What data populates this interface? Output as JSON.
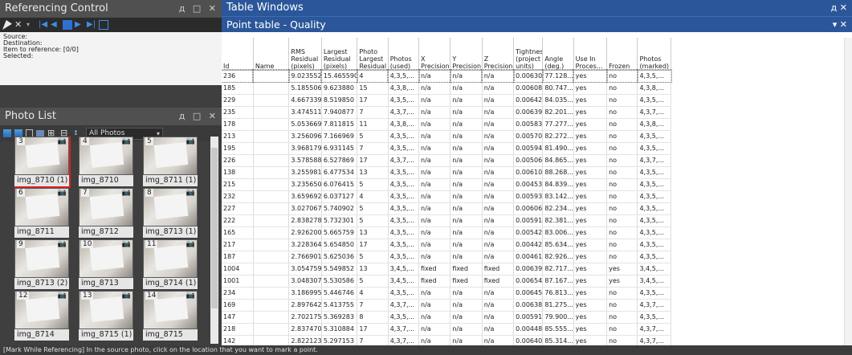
{
  "referencing_control": {
    "title": "Referencing Control",
    "controls": "д □ ✕",
    "info": [
      "Source:",
      "Destination:",
      "Item to reference:  [0/0]",
      "Selected:"
    ]
  },
  "photo_list": {
    "title": "Photo List",
    "controls": "д □ ✕",
    "filter": "All Photos",
    "photos": [
      {
        "num": "3",
        "label": "img_8710 (1)",
        "selected": true
      },
      {
        "num": "4",
        "label": "img_8710",
        "selected": false
      },
      {
        "num": "5",
        "label": "img_8711 (1)",
        "selected": false
      },
      {
        "num": "6",
        "label": "img_8711",
        "selected": false
      },
      {
        "num": "7",
        "label": "img_8712",
        "selected": false
      },
      {
        "num": "8",
        "label": "img_8713 (1)",
        "selected": false
      },
      {
        "num": "9",
        "label": "img_8713 (2)",
        "selected": false
      },
      {
        "num": "10",
        "label": "img_8713",
        "selected": false
      },
      {
        "num": "11",
        "label": "img_8714 (1)",
        "selected": false
      },
      {
        "num": "12",
        "label": "img_8714",
        "selected": false
      },
      {
        "num": "13",
        "label": "img_8715 (1)",
        "selected": false
      },
      {
        "num": "14",
        "label": "img_8715",
        "selected": false
      }
    ]
  },
  "table_windows": {
    "title": "Table Windows",
    "controls": "д ✕",
    "subtitle": "Point table - Quality",
    "sub_controls": "▾ ✕"
  },
  "table": {
    "columns": [
      "Id",
      "Name",
      "RMS Residual (pixels)",
      "Largest Residual (pixels)",
      "Photo Largest Residual",
      "Photos (used)",
      "X Precision",
      "Y Precision",
      "Z Precision",
      "Tightness (project units)",
      "Angle (deg.)",
      "Use In Proces...",
      "Frozen",
      "Photos (marked)"
    ],
    "rows": [
      [
        "236",
        "",
        "9.023552",
        "15.465590",
        "4",
        "4,3,5,...",
        "n/a",
        "n/a",
        "n/a",
        "0.006306",
        "77.128...",
        "yes",
        "no",
        "4,3,5,..."
      ],
      [
        "185",
        "",
        "5.185506",
        "9.623880",
        "15",
        "4,3,8,...",
        "n/a",
        "n/a",
        "n/a",
        "0.006084",
        "80.747...",
        "yes",
        "no",
        "4,3,8,..."
      ],
      [
        "229",
        "",
        "4.667339",
        "8.519850",
        "17",
        "4,3,5,...",
        "n/a",
        "n/a",
        "n/a",
        "0.006427",
        "84.035...",
        "yes",
        "no",
        "4,3,5,..."
      ],
      [
        "235",
        "",
        "3.474511",
        "7.940877",
        "7",
        "4,3,7,...",
        "n/a",
        "n/a",
        "n/a",
        "0.006391",
        "82.201...",
        "yes",
        "no",
        "4,3,7,..."
      ],
      [
        "178",
        "",
        "5.053669",
        "7.811815",
        "11",
        "4,3,8,...",
        "n/a",
        "n/a",
        "n/a",
        "0.005835",
        "77.277...",
        "yes",
        "no",
        "4,3,8,..."
      ],
      [
        "213",
        "",
        "3.256096",
        "7.166969",
        "5",
        "4,3,5,...",
        "n/a",
        "n/a",
        "n/a",
        "0.005707",
        "82.272...",
        "yes",
        "no",
        "4,3,5,..."
      ],
      [
        "195",
        "",
        "3.968179",
        "6.931145",
        "7",
        "4,3,5,...",
        "n/a",
        "n/a",
        "n/a",
        "0.005947",
        "81.490...",
        "yes",
        "no",
        "4,3,5,..."
      ],
      [
        "226",
        "",
        "3.578588",
        "6.527869",
        "17",
        "4,3,7,...",
        "n/a",
        "n/a",
        "n/a",
        "0.005061",
        "84.865...",
        "yes",
        "no",
        "4,3,7,..."
      ],
      [
        "138",
        "",
        "3.255981",
        "6.477534",
        "13",
        "4,3,5,...",
        "n/a",
        "n/a",
        "n/a",
        "0.006103",
        "88.268...",
        "yes",
        "no",
        "4,3,5,..."
      ],
      [
        "215",
        "",
        "3.235650",
        "6.076415",
        "5",
        "4,3,5,...",
        "n/a",
        "n/a",
        "n/a",
        "0.004533",
        "84.839...",
        "yes",
        "no",
        "4,3,5,..."
      ],
      [
        "232",
        "",
        "3.659692",
        "6.037127",
        "4",
        "4,3,5,...",
        "n/a",
        "n/a",
        "n/a",
        "0.005931",
        "83.142...",
        "yes",
        "no",
        "4,3,5,..."
      ],
      [
        "227",
        "",
        "3.027067",
        "5.740902",
        "5",
        "4,3,5,...",
        "n/a",
        "n/a",
        "n/a",
        "0.006069",
        "82.234...",
        "yes",
        "no",
        "4,3,5,..."
      ],
      [
        "222",
        "",
        "2.838278",
        "5.732301",
        "5",
        "4,3,5,...",
        "n/a",
        "n/a",
        "n/a",
        "0.005910",
        "82.381...",
        "yes",
        "no",
        "4,3,5,..."
      ],
      [
        "165",
        "",
        "2.926200",
        "5.665759",
        "13",
        "4,3,5,...",
        "n/a",
        "n/a",
        "n/a",
        "0.005424",
        "83.006...",
        "yes",
        "no",
        "4,3,5,..."
      ],
      [
        "217",
        "",
        "3.228364",
        "5.654850",
        "17",
        "4,3,5,...",
        "n/a",
        "n/a",
        "n/a",
        "0.004428",
        "85.634...",
        "yes",
        "no",
        "4,3,5,..."
      ],
      [
        "187",
        "",
        "2.766901",
        "5.625036",
        "5",
        "4,3,5,...",
        "n/a",
        "n/a",
        "n/a",
        "0.004612",
        "82.926...",
        "yes",
        "no",
        "4,3,5,..."
      ],
      [
        "1004",
        "",
        "3.054759",
        "5.549852",
        "13",
        "3,4,5,...",
        "fixed",
        "fixed",
        "fixed",
        "0.006391",
        "82.717...",
        "yes",
        "yes",
        "3,4,5,..."
      ],
      [
        "1001",
        "",
        "3.048307",
        "5.530586",
        "5",
        "3,4,5,...",
        "fixed",
        "fixed",
        "fixed",
        "0.006540",
        "87.167...",
        "yes",
        "yes",
        "3,4,5,..."
      ],
      [
        "234",
        "",
        "3.186995",
        "5.446746",
        "4",
        "4,3,5,...",
        "n/a",
        "n/a",
        "n/a",
        "0.006454",
        "76.813...",
        "yes",
        "no",
        "4,3,5,..."
      ],
      [
        "169",
        "",
        "2.897642",
        "5.413755",
        "7",
        "4,3,7,...",
        "n/a",
        "n/a",
        "n/a",
        "0.006383",
        "81.275...",
        "yes",
        "no",
        "4,3,7,..."
      ],
      [
        "147",
        "",
        "2.702175",
        "5.369283",
        "8",
        "4,3,5,...",
        "n/a",
        "n/a",
        "n/a",
        "0.005913",
        "79.900...",
        "yes",
        "no",
        "4,3,5,..."
      ],
      [
        "218",
        "",
        "2.837470",
        "5.310884",
        "17",
        "4,3,7,...",
        "n/a",
        "n/a",
        "n/a",
        "0.004481",
        "85.555...",
        "yes",
        "no",
        "4,3,7,..."
      ],
      [
        "142",
        "",
        "2.822123",
        "5.297153",
        "7",
        "4,3,7,...",
        "n/a",
        "n/a",
        "n/a",
        "0.006400",
        "85.314...",
        "yes",
        "no",
        "4,3,7,..."
      ]
    ]
  },
  "status": "[Mark While Referencing] In the source photo, click on the location that you want to mark a point."
}
